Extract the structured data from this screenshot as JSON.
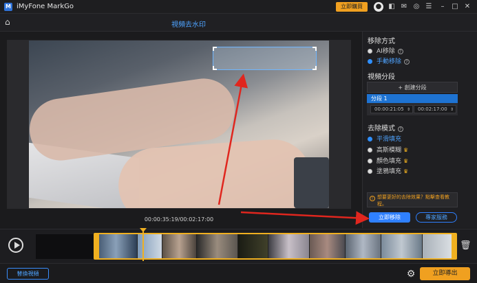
{
  "window": {
    "app_title": "iMyFone MarkGo",
    "logo_glyph": "M",
    "buy_label": "立即購買",
    "icons": [
      "avatar-icon",
      "gamepad-icon",
      "mail-icon",
      "support-icon",
      "settings-icon",
      "minimize-icon",
      "maximize-icon",
      "close-icon"
    ]
  },
  "header": {
    "title": "視頻去水印"
  },
  "video": {
    "timecode": "00:00:35:19/00:02:17:00"
  },
  "panel": {
    "removal_method": {
      "title": "移除方式",
      "options": [
        {
          "label": "AI移除",
          "selected": false
        },
        {
          "label": "手動移除",
          "selected": true
        }
      ]
    },
    "segments": {
      "title": "視頻分段",
      "create_label": "+ 創建分段",
      "item_label": "分段 1",
      "start_time": "00:00:21:05",
      "end_time": "00:02:17:00"
    },
    "removal_mode": {
      "title": "去除模式",
      "options": [
        {
          "label": "平滑填充",
          "selected": true,
          "premium": false
        },
        {
          "label": "高斯模糊",
          "selected": false,
          "premium": true
        },
        {
          "label": "顏色填充",
          "selected": false,
          "premium": true
        },
        {
          "label": "塗鴉填充",
          "selected": false,
          "premium": true
        }
      ]
    },
    "tip": "想要更好的去除效果？點擊查看教程。",
    "remove_button": "立即移除",
    "feedback_button": "專家服務"
  },
  "timeline": {
    "playhead_fraction": 0.258
  },
  "footer": {
    "replace_label": "替換視頻",
    "export_label": "立即導出"
  },
  "colors": {
    "accent_blue": "#2f80ff",
    "accent_orange": "#f0a020",
    "arrow_red": "#e0261e"
  }
}
